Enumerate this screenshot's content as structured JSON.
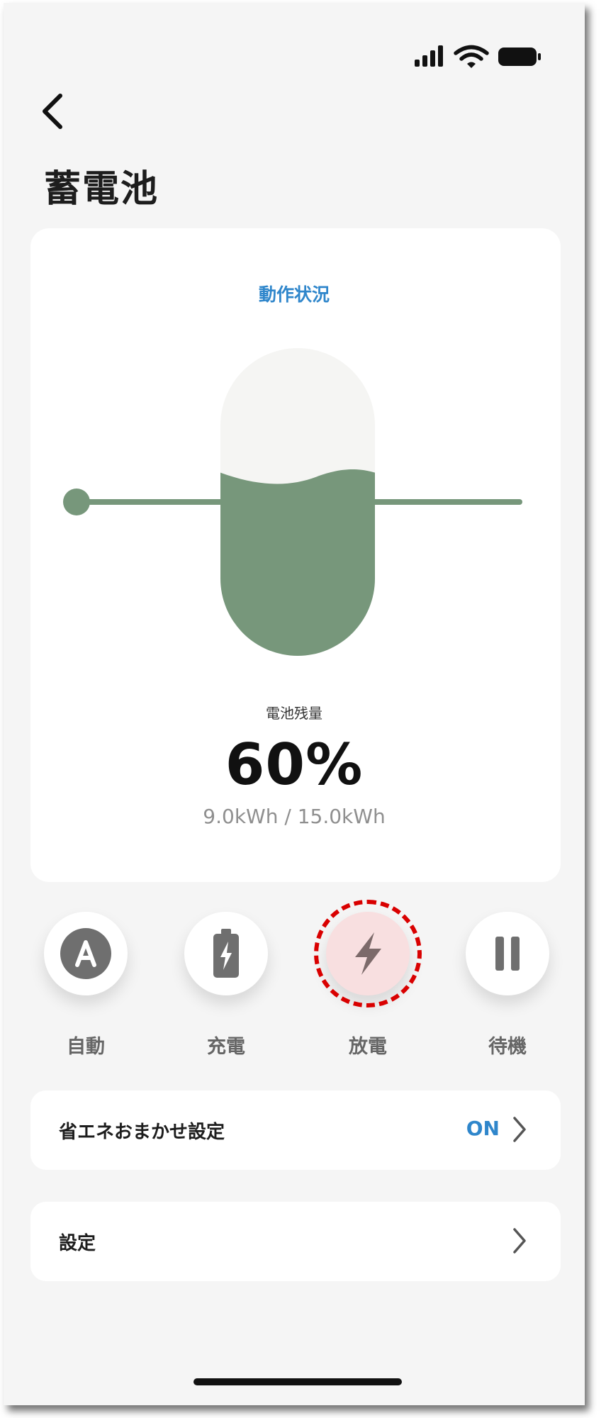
{
  "header": {
    "title": "蓄電池"
  },
  "status_icons": [
    "signal-icon",
    "wifi-icon",
    "battery-icon"
  ],
  "card": {
    "heading": "動作状況",
    "remaining_label": "電池残量",
    "percent": "60%",
    "energy": "9.0kWh / 15.0kWh",
    "fill_level": 0.6
  },
  "modes": [
    {
      "label": "自動",
      "icon": "auto-a-icon",
      "active": false
    },
    {
      "label": "充電",
      "icon": "battery-charging-icon",
      "active": false
    },
    {
      "label": "放電",
      "icon": "lightning-bolt-icon",
      "active": true
    },
    {
      "label": "待機",
      "icon": "pause-icon",
      "active": false
    }
  ],
  "rows": [
    {
      "label": "省エネおまかせ設定",
      "value": "ON"
    },
    {
      "label": "設定",
      "value": ""
    }
  ],
  "colors": {
    "accent_blue": "#2f86cb",
    "battery_green": "#77977b",
    "active_mode_bg": "#f8dfe0",
    "highlight_ring": "#d90000"
  }
}
